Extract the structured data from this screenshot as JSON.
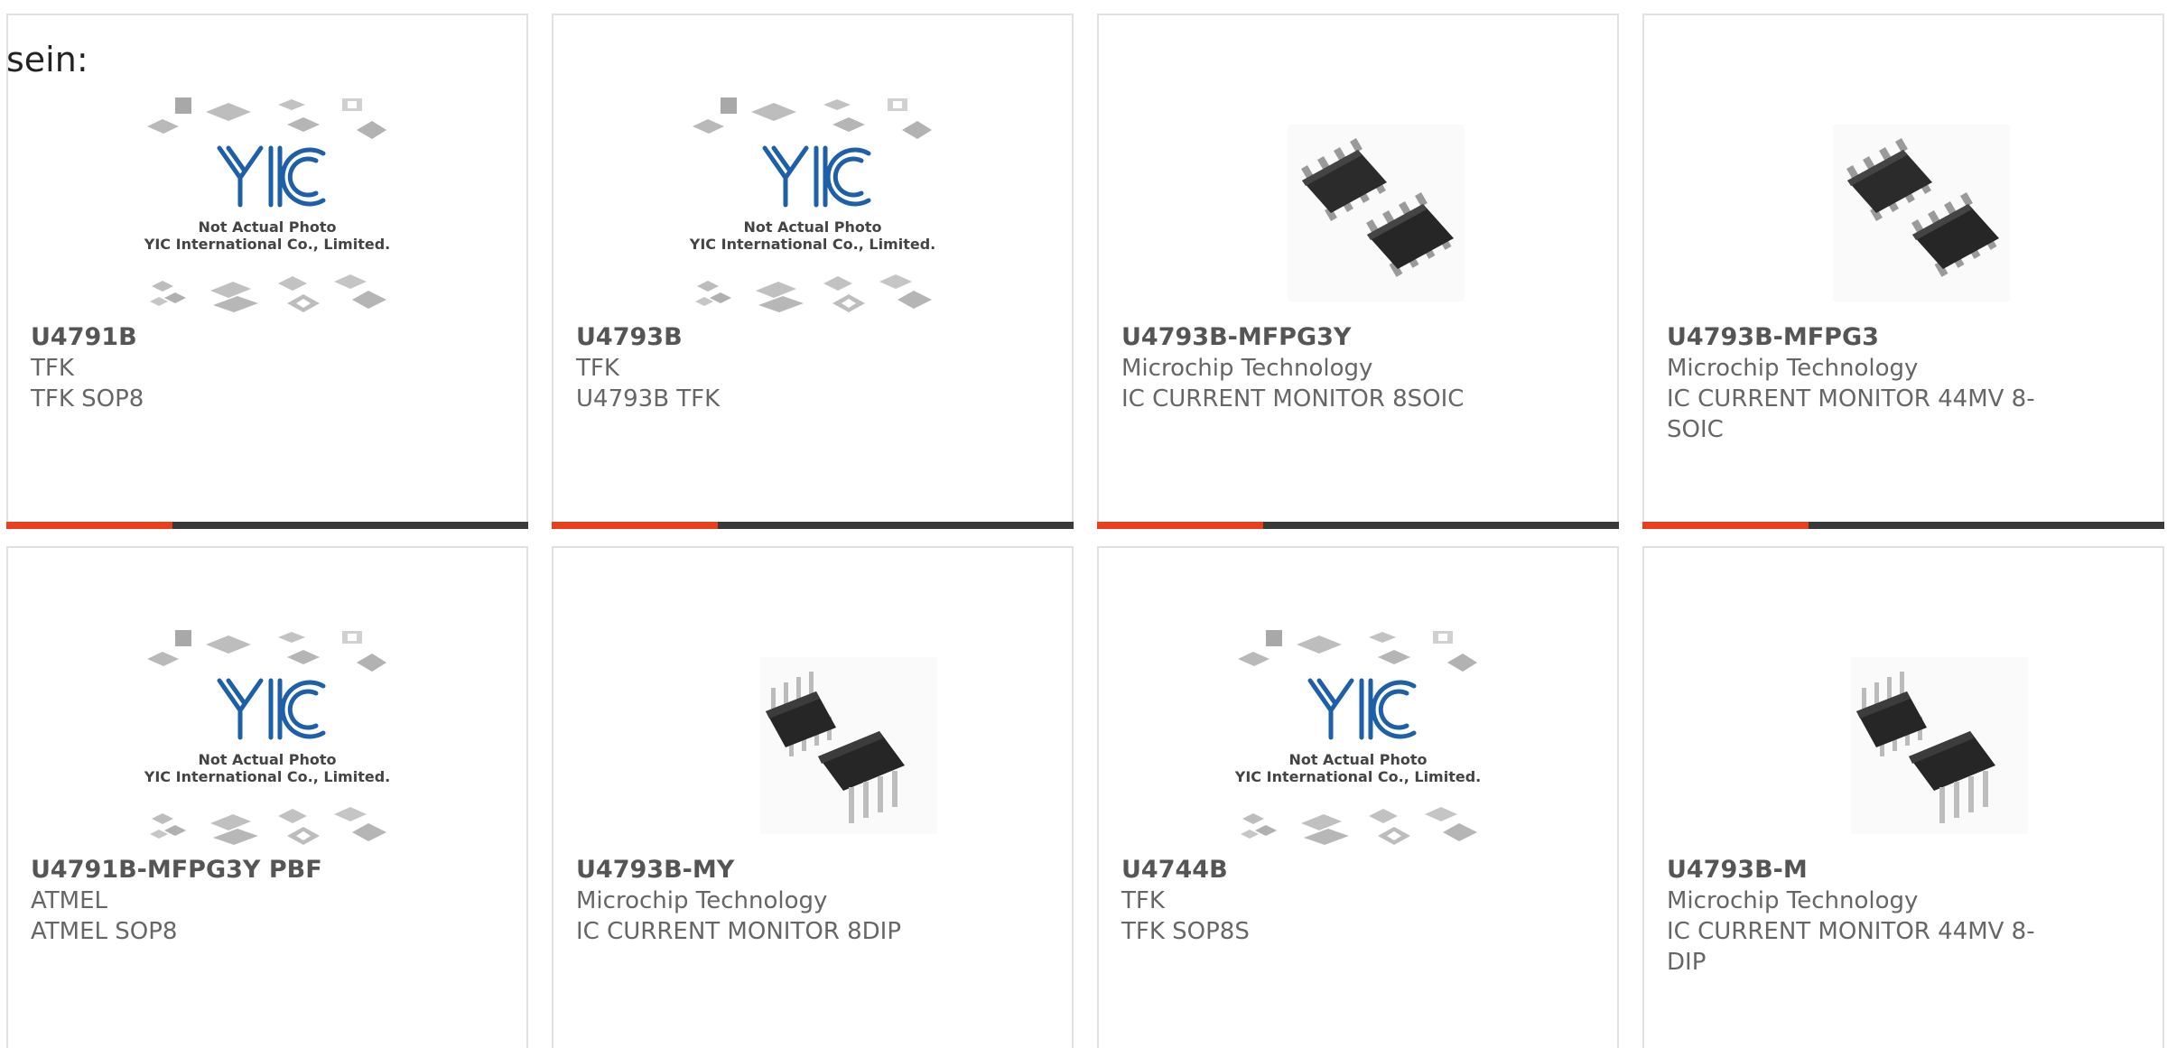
{
  "heading_fragment": "sein:",
  "placeholder_caption": {
    "line1": "Not Actual Photo",
    "line2": "YIC International Co., Limited."
  },
  "brand_logo_text": "YIC",
  "colors": {
    "accent": "#e8401c",
    "bar_dark": "#3a3a3a",
    "logo_blue": "#1d5fa8",
    "text_gray": "#666666"
  },
  "products": [
    {
      "part_number": "U4791B",
      "manufacturer": "TFK",
      "description": "TFK SOP8",
      "image": "yic-placeholder-icon"
    },
    {
      "part_number": "U4793B",
      "manufacturer": "TFK",
      "description": "U4793B TFK",
      "image": "yic-placeholder-icon"
    },
    {
      "part_number": "U4793B-MFPG3Y",
      "manufacturer": "Microchip Technology",
      "description": "IC CURRENT MONITOR 8SOIC",
      "image": "soic8-chip-icon"
    },
    {
      "part_number": "U4793B-MFPG3",
      "manufacturer": "Microchip Technology",
      "description": "IC CURRENT MONITOR 44MV 8-SOIC",
      "image": "soic8-chip-icon"
    },
    {
      "part_number": "U4791B-MFPG3Y PBF",
      "manufacturer": "ATMEL",
      "description": "ATMEL SOP8",
      "image": "yic-placeholder-icon"
    },
    {
      "part_number": "U4793B-MY",
      "manufacturer": "Microchip Technology",
      "description": "IC CURRENT MONITOR 8DIP",
      "image": "dip8-chip-icon"
    },
    {
      "part_number": "U4744B",
      "manufacturer": "TFK",
      "description": "TFK SOP8S",
      "image": "yic-placeholder-icon"
    },
    {
      "part_number": "U4793B-M",
      "manufacturer": "Microchip Technology",
      "description": "IC CURRENT MONITOR 44MV 8-DIP",
      "image": "dip8-chip-icon"
    }
  ]
}
